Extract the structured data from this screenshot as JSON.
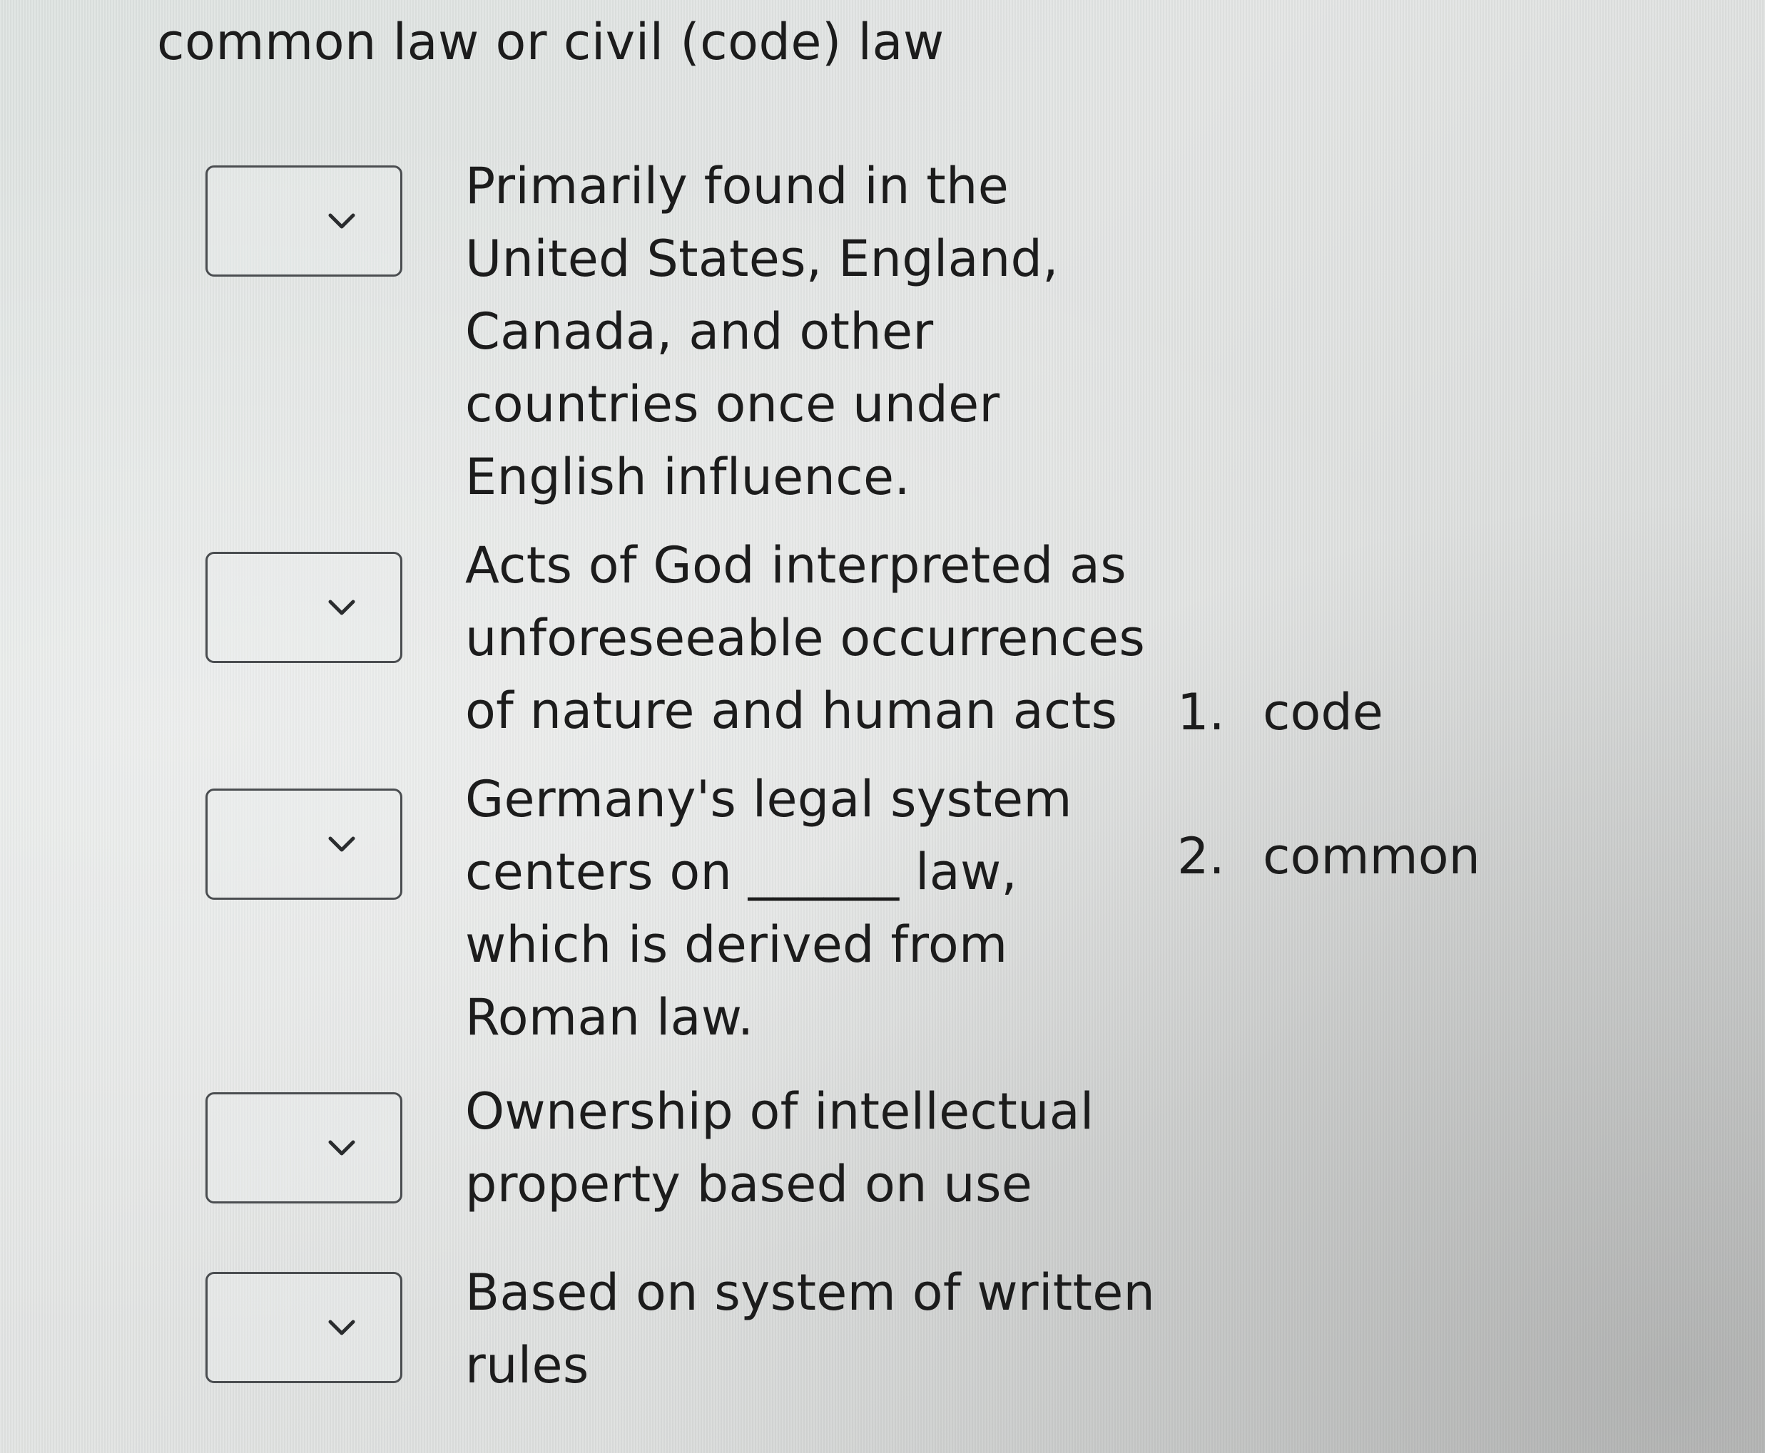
{
  "header": {
    "title": "common law or civil (code) law"
  },
  "questions": [
    {
      "lines": [
        "Primarily found in the",
        "United States, England,",
        "Canada, and other",
        "countries once under",
        "English influence."
      ]
    },
    {
      "lines": [
        "Acts of God interpreted as",
        "unforeseeable occurrences",
        "of nature and human acts"
      ]
    },
    {
      "lines": [
        "Germany's legal system",
        "centers on ______ law,",
        "which is derived from",
        "Roman law."
      ]
    },
    {
      "lines": [
        "Ownership of intellectual",
        "property based on use"
      ]
    },
    {
      "lines": [
        "Based on system of written",
        "rules"
      ]
    }
  ],
  "options": [
    {
      "number": "1.",
      "label": "code"
    },
    {
      "number": "2.",
      "label": "common"
    }
  ],
  "icons": {
    "dropdown": "chevron-down-icon"
  }
}
